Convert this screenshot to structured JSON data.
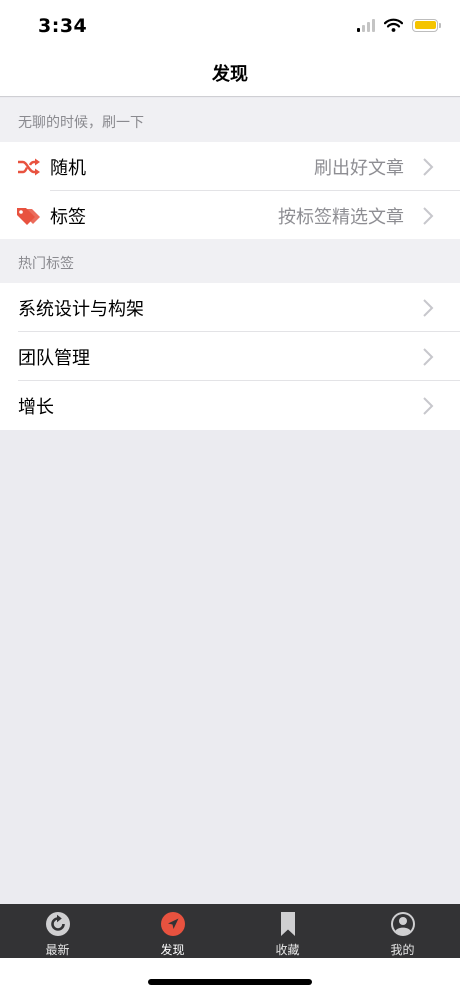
{
  "status": {
    "time": "3:34",
    "battery_color": "#f5c400"
  },
  "nav": {
    "title": "发现"
  },
  "section_refresh": {
    "header": "无聊的时候，刷一下",
    "items": [
      {
        "icon": "shuffle-icon",
        "label": "随机",
        "detail": "刷出好文章"
      },
      {
        "icon": "tag-icon",
        "label": "标签",
        "detail": "按标签精选文章"
      }
    ]
  },
  "section_hot_tags": {
    "header": "热门标签",
    "items": [
      {
        "label": "系统设计与构架"
      },
      {
        "label": "团队管理"
      },
      {
        "label": "增长"
      }
    ]
  },
  "tabs": [
    {
      "icon": "refresh-icon",
      "label": "最新",
      "active": false
    },
    {
      "icon": "compass-icon",
      "label": "发现",
      "active": true
    },
    {
      "icon": "bookmark-icon",
      "label": "收藏",
      "active": false
    },
    {
      "icon": "user-icon",
      "label": "我的",
      "active": false
    }
  ],
  "colors": {
    "accent": "#e8523f",
    "tab_bar": "#333335",
    "background": "#ebebf0"
  }
}
